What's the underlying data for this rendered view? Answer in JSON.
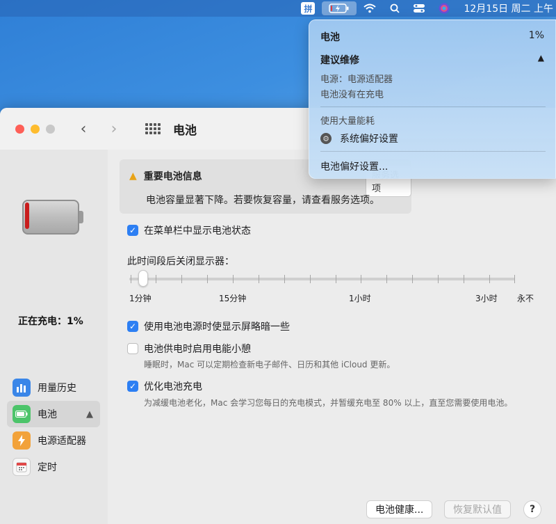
{
  "menubar": {
    "ime_label": "拼",
    "clock": "12月15日 周二 上午"
  },
  "window": {
    "title": "电池"
  },
  "sidebar": {
    "charging_status": "正在充电：1%",
    "items": [
      {
        "label": "用量历史",
        "icon": "bar-chart-icon"
      },
      {
        "label": "电池",
        "icon": "battery-icon",
        "warning": "!"
      },
      {
        "label": "电源适配器",
        "icon": "lightning-icon"
      },
      {
        "label": "定时",
        "icon": "calendar-icon"
      }
    ]
  },
  "main": {
    "info": {
      "title": "重要电池信息",
      "text": "电池容量显著下降。若要恢复容量，请查看服务选项。",
      "service_button": "服务选项"
    },
    "show_in_menubar": "在菜单栏中显示电池状态",
    "slider": {
      "label": "此时间段后关闭显示器：",
      "value": "1分钟",
      "ticks": [
        "1分钟",
        "15分钟",
        "1小时",
        "3小时",
        "永不"
      ]
    },
    "dim_display": "使用电池电源时使显示屏略暗一些",
    "power_nap": "电池供电时启用电能小憩",
    "power_nap_desc": "睡眠时，Mac 可以定期检查新电子邮件、日历和其他 iCloud 更新。",
    "optimize": "优化电池充电",
    "optimize_desc": "为减缓电池老化，Mac 会学习您每日的充电模式，并暂缓充电至 80% 以上，直至您需要使用电池。",
    "battery_health_button": "电池健康...",
    "restore_defaults_button": "恢复默认值",
    "help_button": "?"
  },
  "dropdown": {
    "title": "电池",
    "percent": "1%",
    "condition": "建议维修",
    "source": "电源：电源适配器",
    "status": "电池没有在充电",
    "heavy_usage_header": "使用大量能耗",
    "heavy_app": "系统偏好设置",
    "prefs_link": "电池偏好设置..."
  },
  "colors": {
    "accent": "#2d7ff3",
    "battery_red": "#c91d1d",
    "warning": "#e8a317"
  }
}
